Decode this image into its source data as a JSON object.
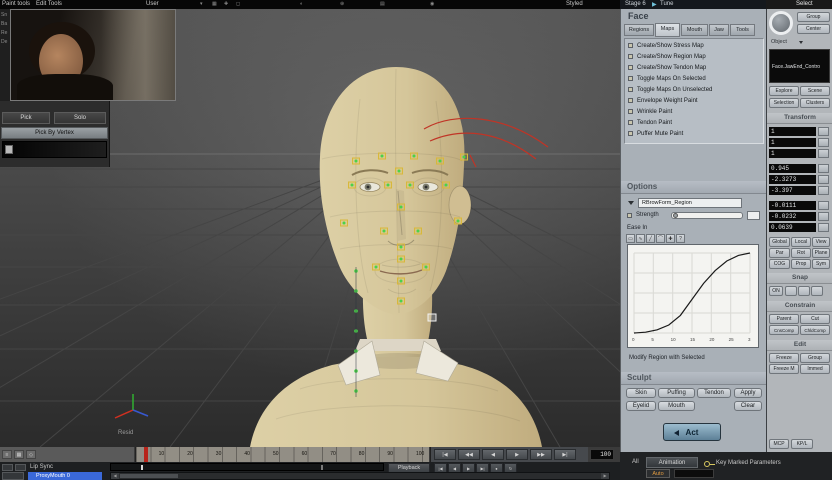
{
  "colors": {
    "selection_blue": "#3a68d8",
    "auto_orange": "#e09a40",
    "playhead_red": "#b8241a",
    "model_skin": "#d5c69a",
    "act_button": "#7fa3b8",
    "marker_yellow": "#d8b83a",
    "control_green": "#4ad24a",
    "muscle_red": "#c03426"
  },
  "menubar": {
    "items": [
      "Paint tools",
      "Edit Tools",
      "User"
    ],
    "right_label": "Styled",
    "icon_glyphs": [
      "▾",
      "▦",
      "✚",
      "◻",
      "◐",
      "⊕",
      "▤",
      "◉"
    ]
  },
  "stage_bar": {
    "stage": "Stage 6",
    "arrow": "▶",
    "mode": "Tune"
  },
  "left_toolbar_fragments": [
    "Sn",
    "Ba",
    "Re",
    "De"
  ],
  "paint_panel": {
    "pick": "Pick",
    "solo": "Solo",
    "pick_by_vertex": "Pick By Vertex"
  },
  "viewport": {
    "label": "Resid"
  },
  "face_panel": {
    "title": "Face",
    "tabs": [
      "Regions",
      "Maps",
      "Mouth",
      "Jaw",
      "Tools"
    ],
    "map_items": [
      "Create/Show Stress Map",
      "Create/Show Region Map",
      "Create/Show Tendon Map",
      "Toggle Maps On Selected",
      "Toggle Maps On Unselected",
      "Envelope Weight Paint",
      "Wrinkle Paint",
      "Tendon Paint",
      "Puffer Mute Paint"
    ],
    "options": {
      "title": "Options",
      "region": "RBrowForm_Region",
      "strength": "Strength",
      "ease": "Ease In",
      "footer": "Modify Region with Selected",
      "tool_glyphs": [
        "▭",
        "∿",
        "╱",
        "⌒",
        "✚",
        "?"
      ],
      "curve": {
        "x_ticks": [
          "0",
          "5",
          "10",
          "15",
          "20",
          "25",
          "3"
        ],
        "points": [
          [
            0,
            0
          ],
          [
            3,
            0.01
          ],
          [
            6,
            0.04
          ],
          [
            9,
            0.1
          ],
          [
            12,
            0.22
          ],
          [
            15,
            0.42
          ],
          [
            18,
            0.62
          ],
          [
            21,
            0.78
          ],
          [
            24,
            0.9
          ],
          [
            27,
            0.97
          ],
          [
            30,
            1
          ]
        ]
      }
    },
    "sculpt": {
      "title": "Sculpt",
      "buttons": [
        "Skin",
        "Puffing",
        "Tendon",
        "Eyelid",
        "Mouth"
      ],
      "apply": "Apply",
      "clear": "Clear",
      "act": "Act"
    }
  },
  "mcp": {
    "select": {
      "title": "Select",
      "group": "Group",
      "center": "Center",
      "object": "Object",
      "selection": "Face.JawEnd_Contro",
      "explore": "Explore",
      "scene": "Scene",
      "selection_btn": "Selection",
      "clusters": "Clusters"
    },
    "transform": {
      "title": "Transform",
      "scale": [
        "1",
        "1",
        "1"
      ],
      "rotation": [
        "0.945",
        "-2.3273",
        "-3.397"
      ],
      "translation": [
        "-0.0111",
        "-0.0232",
        "0.0639"
      ],
      "mode_buttons": [
        "Global",
        "Local",
        "View"
      ],
      "ref_buttons": [
        "Par",
        "Rot",
        "Plane"
      ],
      "opt_buttons": [
        "COG",
        "Prop",
        "Sym"
      ]
    },
    "snap": {
      "title": "Snap",
      "on": "ON"
    },
    "constrain": {
      "title": "Constrain",
      "row1": [
        "Parent",
        "Cut"
      ],
      "row2": [
        "CnsComp",
        "ChldComp"
      ]
    },
    "edit": {
      "title": "Edit",
      "row1": [
        "Freeze",
        "Group"
      ],
      "row2": [
        "Freeze M",
        "Immed"
      ]
    },
    "tabs": [
      "MCP",
      "KP/L"
    ]
  },
  "timeline": {
    "tick_labels": [
      "10",
      "20",
      "30",
      "40",
      "50",
      "60",
      "70",
      "80",
      "90",
      "100"
    ],
    "end_frame": "100",
    "playback": "Playback",
    "left_icons": [
      "≡",
      "▦",
      "◇"
    ],
    "transport_glyphs": [
      "|◀",
      "◀◀",
      "◀",
      "▶",
      "▶▶",
      "▶|"
    ]
  },
  "bottom_bar": {
    "lip_sync": "Lip Sync",
    "proxy_track": "ProxyMouth 0",
    "all": "All",
    "animation": "Animation",
    "auto": "Auto",
    "key_marked": "Key Marked Parameters",
    "transport_glyphs": [
      "|◀",
      "◀",
      "▶",
      "▶|",
      "●",
      "↻"
    ]
  }
}
